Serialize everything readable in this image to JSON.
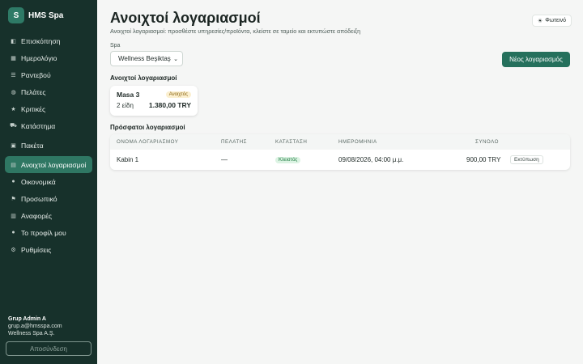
{
  "brand": {
    "logo_letter": "S",
    "name": "HMS Spa"
  },
  "nav": [
    {
      "label": "Επισκόπηση",
      "icon": "overview-icon",
      "glyph": "◧"
    },
    {
      "label": "Ημερολόγιο",
      "icon": "calendar-icon",
      "glyph": "▦"
    },
    {
      "label": "Ραντεβού",
      "icon": "list-icon",
      "glyph": "☰"
    },
    {
      "label": "Πελάτες",
      "icon": "clients-icon",
      "glyph": "◍"
    },
    {
      "label": "Κριτικές",
      "icon": "star-icon",
      "glyph": "★"
    },
    {
      "label": "Κατάστημα",
      "icon": "cart-icon",
      "glyph": "⛟"
    },
    {
      "label": "Πακέτα",
      "icon": "package-icon",
      "glyph": "▣"
    },
    {
      "label": "Ανοιχτοί λογαριασμοί",
      "icon": "receipt-icon",
      "glyph": "▤",
      "active": true
    },
    {
      "label": "Οικονομικά",
      "icon": "money-icon",
      "glyph": "●"
    },
    {
      "label": "Προσωπικό",
      "icon": "flag-icon",
      "glyph": "⚑"
    },
    {
      "label": "Αναφορές",
      "icon": "chart-icon",
      "glyph": "▥"
    },
    {
      "label": "Το προφίλ μου",
      "icon": "user-icon",
      "glyph": "●"
    },
    {
      "label": "Ρυθμίσεις",
      "icon": "gear-icon",
      "glyph": "⚙"
    }
  ],
  "user": {
    "name": "Grup Admin A",
    "email": "grup.a@hmsspa.com",
    "company": "Wellness Spa A.Ş."
  },
  "logout_label": "Αποσύνδεση",
  "header": {
    "title": "Ανοιχτοί λογαριασμοί",
    "subtitle": "Ανοιχτοί λογαριασμοί: προσθέστε υπηρεσίες/προϊόντα, κλείστε σε ταμείο και εκτυπώστε απόδειξη",
    "theme_label": "Φωτεινό"
  },
  "spa": {
    "label": "Spa",
    "selected": "Wellness Beşiktaş"
  },
  "new_button": "Νέος λογαριασμός",
  "open_section": {
    "title": "Ανοιχτοί λογαριασμοί",
    "cards": [
      {
        "name": "Masa 3",
        "status": "Ανοιχτός",
        "items": "2 είδη",
        "total": "1.380,00 TRY"
      }
    ]
  },
  "recent_section": {
    "title": "Πρόσφατοι λογαριασμοί",
    "columns": [
      "ΟΝΟΜΑ ΛΟΓΑΡΙΑΣΜΟΥ",
      "ΠΕΛΑΤΗΣ",
      "ΚΑΤΑΣΤΑΣΗ",
      "ΗΜΕΡΟΜΗΝΙΑ",
      "ΣΥΝΟΛΟ"
    ],
    "rows": [
      {
        "name": "Kabin 1",
        "client": "—",
        "status": "Κλειστός",
        "date": "09/08/2026, 04:00 μ.μ.",
        "total": "900,00 TRY",
        "action": "Εκτύπωση"
      }
    ]
  },
  "colors": {
    "sidebar": "#17312b",
    "accent": "#25705c",
    "active_nav": "#2f7763"
  }
}
